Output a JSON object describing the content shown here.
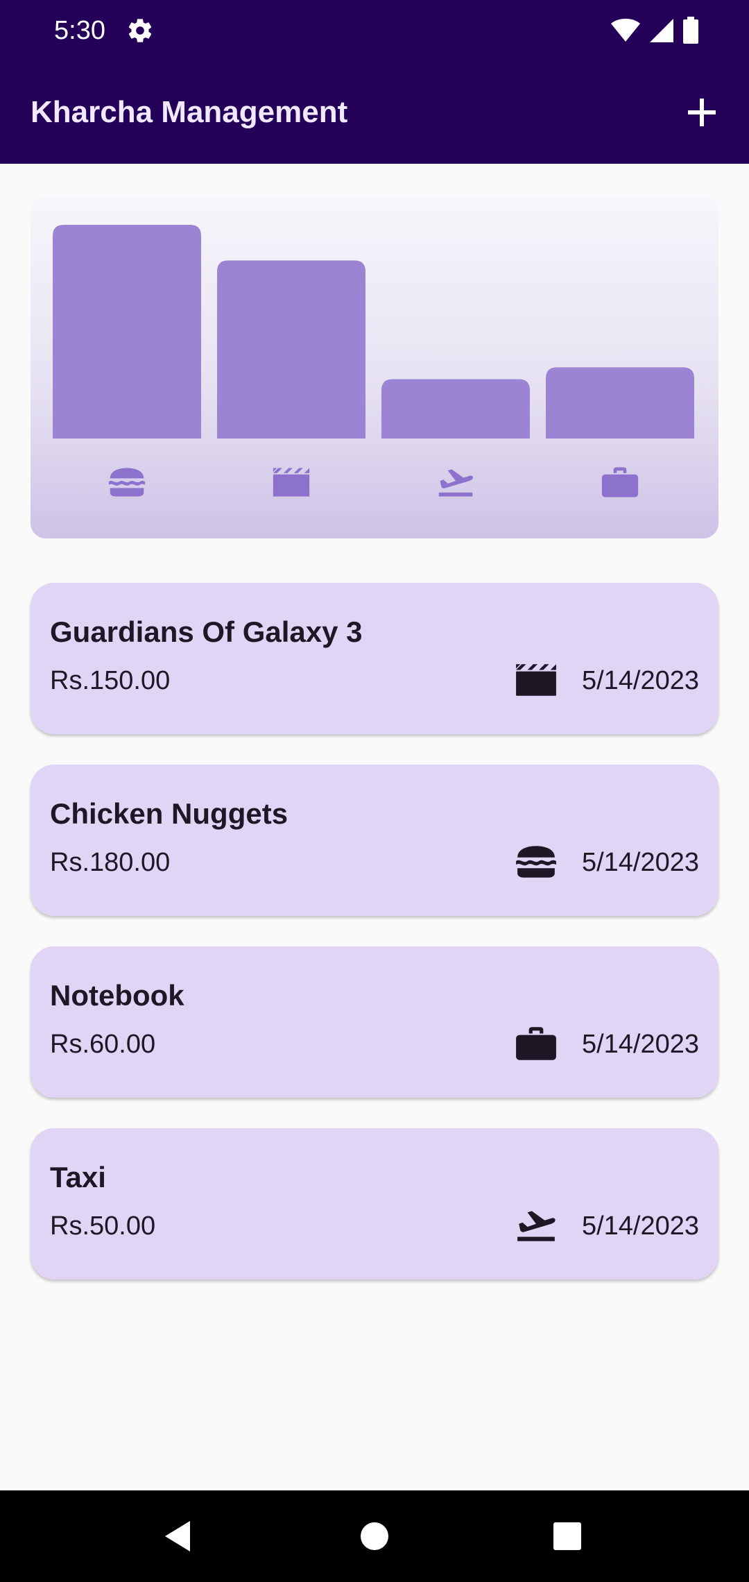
{
  "status_bar": {
    "time": "5:30"
  },
  "app_bar": {
    "title": "Kharcha Management",
    "add_icon": "plus-icon"
  },
  "chart_data": {
    "type": "bar",
    "categories": [
      "food",
      "entertainment",
      "travel",
      "work"
    ],
    "category_icons": [
      "burger-icon",
      "movie-clapper-icon",
      "flight-takeoff-icon",
      "briefcase-icon"
    ],
    "values": [
      180,
      150,
      50,
      60
    ],
    "ylim": [
      0,
      180
    ],
    "title": "",
    "xlabel": "",
    "ylabel": "",
    "bar_color": "#9b84d3",
    "grid": false
  },
  "expenses": [
    {
      "title": "Guardians Of Galaxy 3",
      "amount": "Rs.150.00",
      "date": "5/14/2023",
      "icon": "movie-clapper-icon"
    },
    {
      "title": "Chicken Nuggets",
      "amount": "Rs.180.00",
      "date": "5/14/2023",
      "icon": "burger-icon"
    },
    {
      "title": "Notebook",
      "amount": "Rs.60.00",
      "date": "5/14/2023",
      "icon": "briefcase-icon"
    },
    {
      "title": "Taxi",
      "amount": "Rs.50.00",
      "date": "5/14/2023",
      "icon": "flight-takeoff-icon"
    }
  ],
  "colors": {
    "app_bar": "#250059",
    "card": "#e0d5f5",
    "bar": "#9b84d3",
    "icon_light": "#8c72cc",
    "icon_dark": "#1d1726"
  },
  "nav_bar": {
    "back_icon": "back-triangle-icon",
    "home_icon": "home-circle-icon",
    "recents_icon": "recents-square-icon"
  }
}
